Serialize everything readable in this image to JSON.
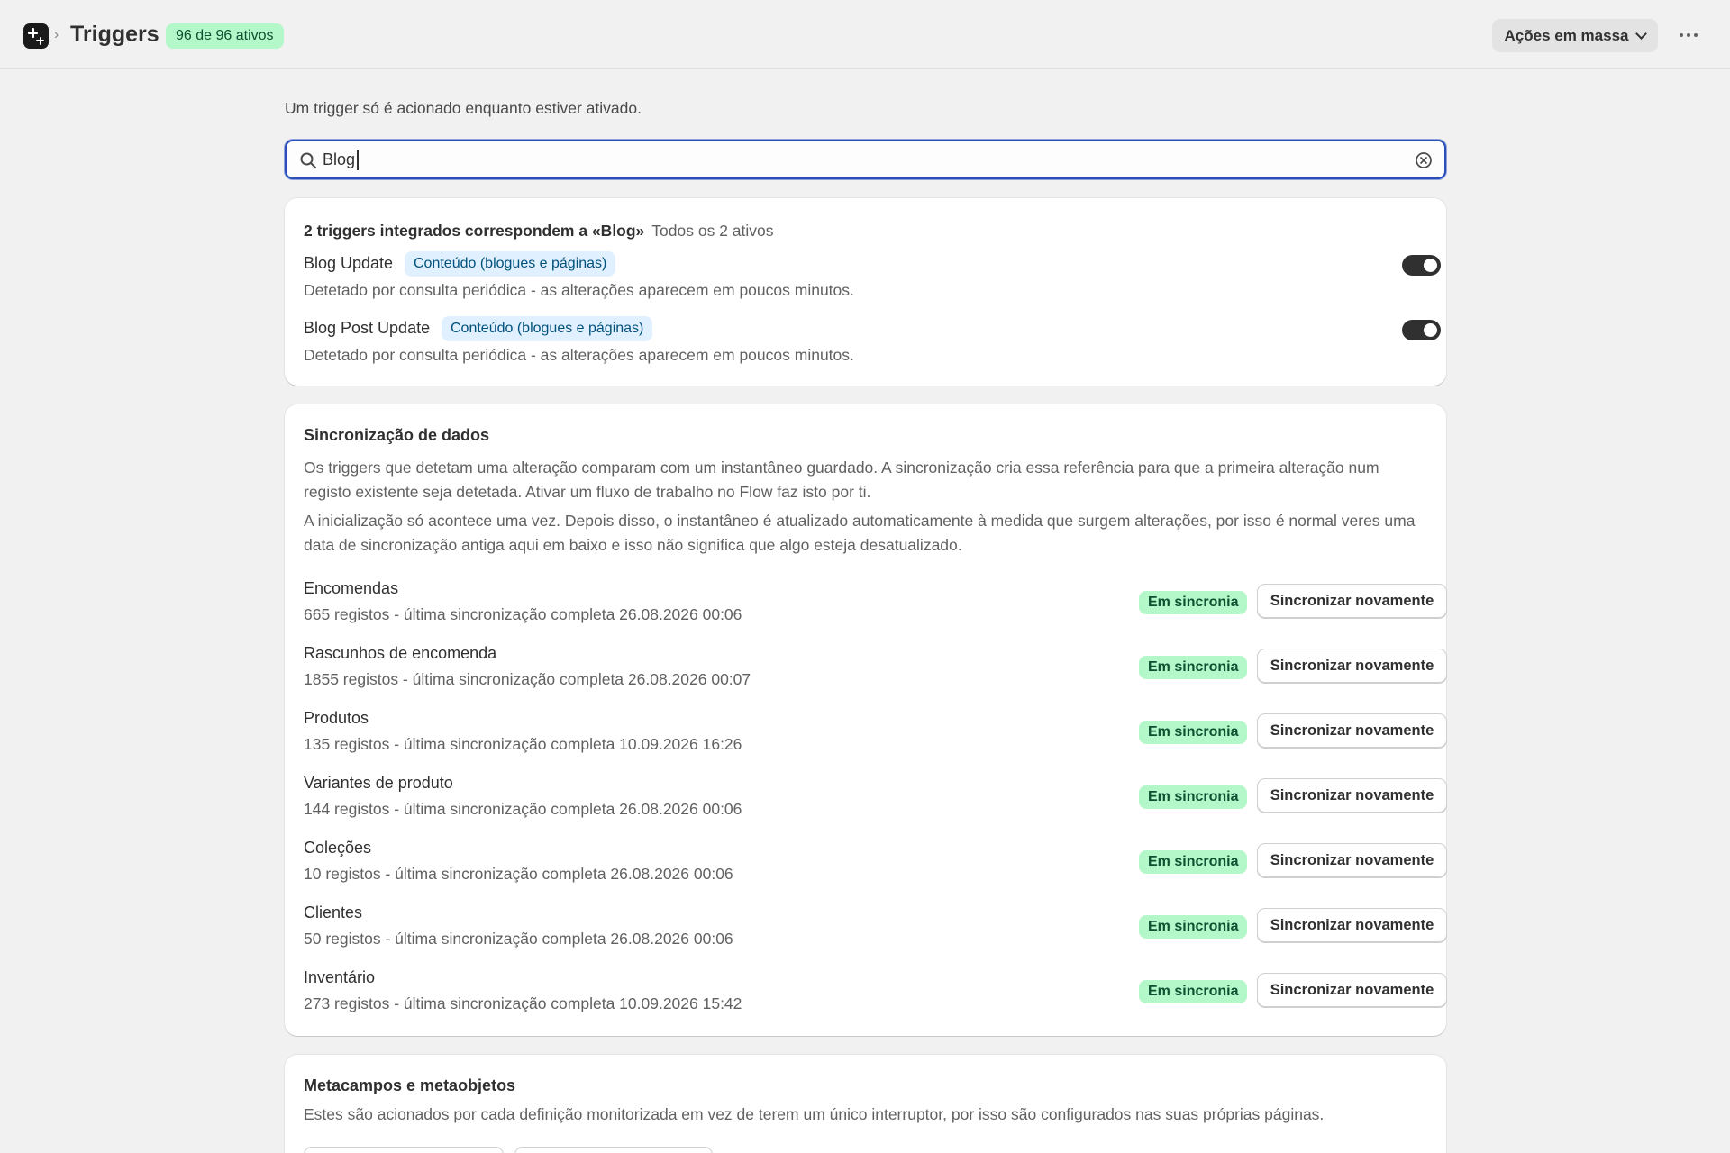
{
  "header": {
    "title": "Triggers",
    "active_badge": "96 de 96 ativos",
    "bulk_actions_label": "Ações em massa"
  },
  "intro": "Um trigger só é acionado enquanto estiver ativado.",
  "search": {
    "value": "Blog",
    "placeholder": ""
  },
  "matches": {
    "heading": "2 triggers integrados correspondem a «Blog»",
    "subheading": "Todos os 2 ativos",
    "items": [
      {
        "name": "Blog Update",
        "category": "Conteúdo (blogues e páginas)",
        "description": "Detetado por consulta periódica - as alterações aparecem em poucos minutos.",
        "enabled": true
      },
      {
        "name": "Blog Post Update",
        "category": "Conteúdo (blogues e páginas)",
        "description": "Detetado por consulta periódica - as alterações aparecem em poucos minutos.",
        "enabled": true
      }
    ]
  },
  "sync": {
    "title": "Sincronização de dados",
    "paragraph1": "Os triggers que detetam uma alteração comparam com um instantâneo guardado. A sincronização cria essa referência para que a primeira alteração num registo existente seja detetada. Ativar um fluxo de trabalho no Flow faz isto por ti.",
    "paragraph2": "A inicialização só acontece uma vez. Depois disso, o instantâneo é atualizado automaticamente à medida que surgem alterações, por isso é normal veres uma data de sincronização antiga aqui em baixo e isso não significa que algo esteja desatualizado.",
    "status_label": "Em sincronia",
    "button_label": "Sincronizar novamente",
    "rows": [
      {
        "name": "Encomendas",
        "meta": "665 registos - última sincronização completa 26.08.2026 00:06"
      },
      {
        "name": "Rascunhos de encomenda",
        "meta": "1855 registos - última sincronização completa 26.08.2026 00:07"
      },
      {
        "name": "Produtos",
        "meta": "135 registos - última sincronização completa 10.09.2026 16:26"
      },
      {
        "name": "Variantes de produto",
        "meta": "144 registos - última sincronização completa 26.08.2026 00:06"
      },
      {
        "name": "Coleções",
        "meta": "10 registos - última sincronização completa 26.08.2026 00:06"
      },
      {
        "name": "Clientes",
        "meta": "50 registos - última sincronização completa 26.08.2026 00:06"
      },
      {
        "name": "Inventário",
        "meta": "273 registos - última sincronização completa 10.09.2026 15:42"
      }
    ]
  },
  "metafields": {
    "title": "Metacampos e metaobjetos",
    "paragraph": "Estes são acionados por cada definição monitorizada em vez de terem um único interruptor, por isso são configurados nas suas próprias páginas."
  },
  "colors": {
    "accent_focus": "#2b4fb6",
    "success_bg": "#b4f7c9",
    "success_text": "#0c5132",
    "info_bg": "#e0f0ff",
    "info_text": "#00527c"
  }
}
